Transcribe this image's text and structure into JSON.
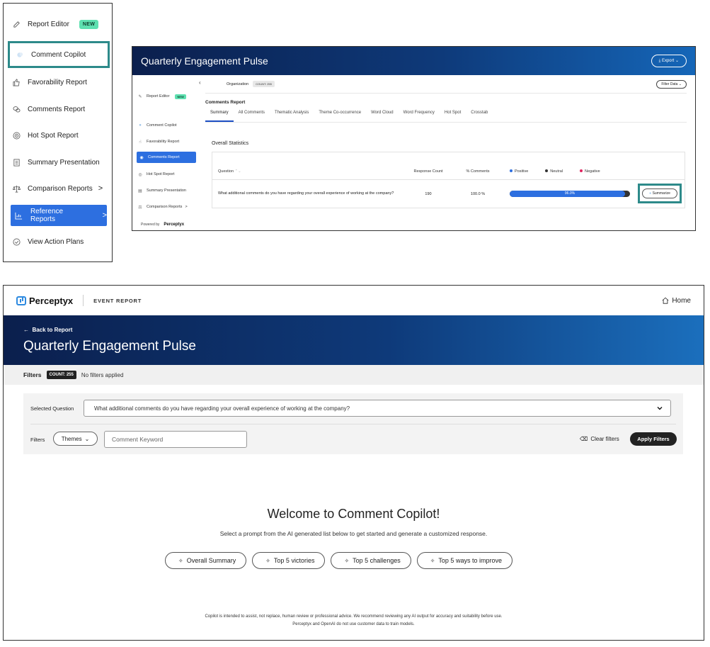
{
  "menu": {
    "items": [
      {
        "label": "Report Editor",
        "badge": "NEW"
      },
      {
        "label": "Comment Copilot"
      },
      {
        "label": "Favorability Report"
      },
      {
        "label": "Comments Report"
      },
      {
        "label": "Hot Spot Report"
      },
      {
        "label": "Summary Presentation"
      },
      {
        "label": "Comparison Reports",
        "chevron": ">"
      },
      {
        "label": "Reference Reports",
        "chevron": ">"
      },
      {
        "label": "View Action Plans"
      }
    ]
  },
  "report": {
    "title": "Quarterly Engagement Pulse",
    "export_label": "Export",
    "collapse": "‹",
    "sidebar": [
      {
        "label": "Report Editor",
        "badge": "NEW"
      },
      {
        "label": "Comment Copilot"
      },
      {
        "label": "Favorability Report"
      },
      {
        "label": "Comments Report"
      },
      {
        "label": "Hot Spot Report"
      },
      {
        "label": "Summary Presentation"
      },
      {
        "label": "Comparison Reports",
        "chevron": ">"
      }
    ],
    "powered_by": "Powered by",
    "powered_brand": "Perceptyx",
    "org_label": "Organization",
    "count_label": "COUNT: 255",
    "filter_label": "Filter Data",
    "section_title": "Comments Report",
    "tabs": [
      "Summary",
      "All Comments",
      "Thematic Analysis",
      "Theme Co-occurrence",
      "Word Cloud",
      "Word Frequency",
      "Hot Spot",
      "Crosstab"
    ],
    "stats_title": "Overall Statistics",
    "columns": {
      "question": "Question",
      "response_count": "Response Count",
      "pct_comments": "% Comments",
      "positive": "Positive",
      "neutral": "Neutral",
      "negative": "Negative"
    },
    "row": {
      "question": "What additional comments do you have regarding your overall experience of working at the company?",
      "response_count": "190",
      "pct_comments": "100.0 %",
      "bar_label": "96.0%",
      "positive_fraction": 0.96
    },
    "summarize_label": "Summarize",
    "colors": {
      "positive": "#2d6fe0",
      "neutral": "#333333",
      "negative": "#e0245e"
    }
  },
  "copilot": {
    "brand": "Perceptyx",
    "event_label": "EVENT REPORT",
    "home_label": "Home",
    "back_label": "Back to Report",
    "title": "Quarterly Engagement Pulse",
    "filters_label": "Filters",
    "count_label": "COUNT: 255",
    "no_filters": "No filters applied",
    "selected_question_label": "Selected Question",
    "selected_question": "What additional comments do you have regarding your overall experience of working at the company?",
    "filters_row_label": "Filters",
    "themes_label": "Themes",
    "keyword_placeholder": "Comment Keyword",
    "clear_filters": "Clear filters",
    "apply_filters": "Apply Filters",
    "welcome": "Welcome to Comment Copilot!",
    "subtitle": "Select a prompt from the AI generated list below to get started and generate a customized response.",
    "prompts": [
      "Overall Summary",
      "Top 5 victories",
      "Top 5 challenges",
      "Top 5 ways to improve"
    ],
    "disclaimer_line1": "Copilot is intended to assist, not replace, human review or professional advice. We recommend reviewing any AI output for accuracy and suitability before use.",
    "disclaimer_line2": "Perceptyx and OpenAI do not use customer data to train models."
  }
}
